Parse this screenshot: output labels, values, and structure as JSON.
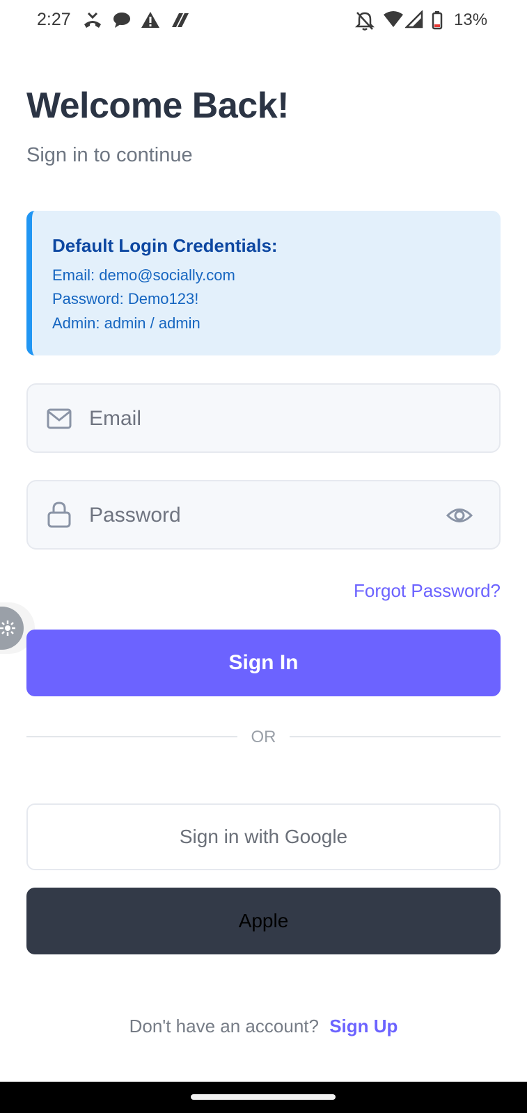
{
  "status_bar": {
    "time": "2:27",
    "battery": "13%",
    "icons": [
      "missed-call-icon",
      "chat-bubble-icon",
      "warning-icon",
      "app-icon",
      "notifications-off-icon",
      "wifi-icon",
      "signal-icon",
      "battery-icon"
    ]
  },
  "header": {
    "title": "Welcome Back!",
    "subtitle": "Sign in to continue"
  },
  "credentials": {
    "title": "Default Login Credentials:",
    "email_line": "Email: demo@socially.com",
    "password_line": "Password: Demo123!",
    "admin_line": "Admin: admin / admin",
    "accent_color": "#2196f3",
    "background_color": "#e3f0fb"
  },
  "form": {
    "email": {
      "placeholder": "Email",
      "value": "",
      "icon": "mail-icon"
    },
    "password": {
      "placeholder": "Password",
      "value": "",
      "icon": "lock-icon",
      "toggle_icon": "eye-icon"
    },
    "forgot_password": "Forgot Password?",
    "sign_in": "Sign In",
    "divider": "OR",
    "google": "Sign in with Google",
    "apple": "Apple"
  },
  "footer": {
    "prompt": "Don't have an account?",
    "signup": "Sign Up"
  },
  "colors": {
    "primary": "#6c63ff",
    "title": "#2b3444",
    "apple_button": "#333a48"
  }
}
